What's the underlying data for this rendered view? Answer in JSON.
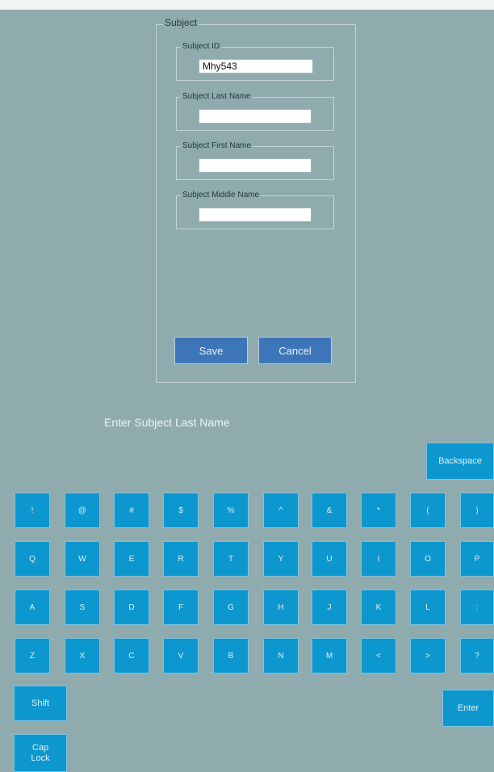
{
  "panel": {
    "legend": "Subject",
    "subject_id": {
      "label": "Subject ID",
      "value": "Mhy543"
    },
    "last_name": {
      "label": "Subject Last Name",
      "value": ""
    },
    "first_name": {
      "label": "Subject First Name",
      "value": ""
    },
    "middle_name": {
      "label": "Subject Middle Name",
      "value": ""
    },
    "save_label": "Save",
    "cancel_label": "Cancel"
  },
  "prompt": "Enter Subject Last Name",
  "keyboard": {
    "backspace": "Backspace",
    "row1": [
      "!",
      "@",
      "#",
      "$",
      "%",
      "^",
      "&",
      "*",
      "(",
      ")"
    ],
    "row2": [
      "Q",
      "W",
      "E",
      "R",
      "T",
      "Y",
      "U",
      "I",
      "O",
      "P"
    ],
    "row3": [
      "A",
      "S",
      "D",
      "F",
      "G",
      "H",
      "J",
      "K",
      "L",
      ":"
    ],
    "row4": [
      "Z",
      "X",
      "C",
      "V",
      "B",
      "N",
      "M",
      "<",
      ">",
      "?"
    ],
    "shift": "Shift",
    "enter": "Enter",
    "cap_lock": "Cap\nLock"
  }
}
